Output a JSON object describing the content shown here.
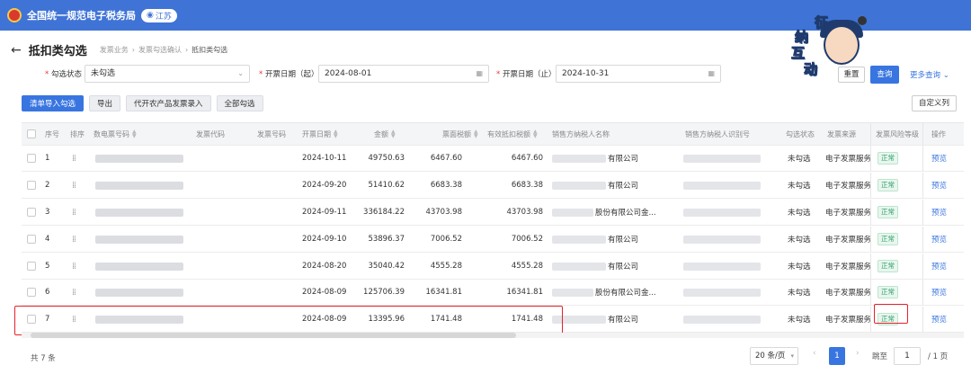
{
  "topbar": {
    "brand": "全国统一规范电子税务局",
    "region": "江苏",
    "region_icon": "location-icon"
  },
  "mascot": {
    "chars": [
      "征",
      "纳",
      "互",
      "动"
    ]
  },
  "header": {
    "back_icon": "←",
    "title": "抵扣类勾选",
    "breadcrumb": [
      "发票业务",
      "发票勾选确认",
      "抵扣类勾选"
    ]
  },
  "filters": {
    "status_label": "勾选状态",
    "status_value": "未勾选",
    "start_label": "开票日期（起）",
    "start_value": "2024-08-01",
    "end_label": "开票日期（止）",
    "end_value": "2024-10-31",
    "reset": "重置",
    "query": "查询",
    "more": "更多查询"
  },
  "actions": {
    "import": "清单导入勾选",
    "export": "导出",
    "agri": "代开农产品发票录入",
    "all": "全部勾选",
    "custom_cols": "自定义列"
  },
  "table": {
    "headers": {
      "index": "序号",
      "sort": "排序",
      "einv": "数电票号码",
      "code": "发票代码",
      "num": "发票号码",
      "date": "开票日期",
      "amount": "金额",
      "tax": "票面税额",
      "eff_tax": "有效抵扣税额",
      "seller": "销售方纳税人名称",
      "seller_id": "销售方纳税人识别号",
      "status": "勾选状态",
      "source": "发票来源",
      "risk": "发票风险等级",
      "op": "操作"
    },
    "rows": [
      {
        "index": "1",
        "date": "2024-10-11",
        "amount": "49750.63",
        "tax": "6467.60",
        "eff_tax": "6467.60",
        "seller": "有限公司",
        "status": "未勾选",
        "source": "电子发票服务",
        "risk": "正常",
        "op": "预览"
      },
      {
        "index": "2",
        "date": "2024-09-20",
        "amount": "51410.62",
        "tax": "6683.38",
        "eff_tax": "6683.38",
        "seller": "有限公司",
        "status": "未勾选",
        "source": "电子发票服务",
        "risk": "正常",
        "op": "预览"
      },
      {
        "index": "3",
        "date": "2024-09-11",
        "amount": "336184.22",
        "tax": "43703.98",
        "eff_tax": "43703.98",
        "seller": "股份有限公司金...",
        "status": "未勾选",
        "source": "电子发票服务",
        "risk": "正常",
        "op": "预览"
      },
      {
        "index": "4",
        "date": "2024-09-10",
        "amount": "53896.37",
        "tax": "7006.52",
        "eff_tax": "7006.52",
        "seller": "有限公司",
        "status": "未勾选",
        "source": "电子发票服务",
        "risk": "正常",
        "op": "预览"
      },
      {
        "index": "5",
        "date": "2024-08-20",
        "amount": "35040.42",
        "tax": "4555.28",
        "eff_tax": "4555.28",
        "seller": "有限公司",
        "status": "未勾选",
        "source": "电子发票服务",
        "risk": "正常",
        "op": "预览"
      },
      {
        "index": "6",
        "date": "2024-08-09",
        "amount": "125706.39",
        "tax": "16341.81",
        "eff_tax": "16341.81",
        "seller": "股份有限公司金...",
        "status": "未勾选",
        "source": "电子发票服务",
        "risk": "正常",
        "op": "预览"
      },
      {
        "index": "7",
        "date": "2024-08-09",
        "amount": "13395.96",
        "tax": "1741.48",
        "eff_tax": "1741.48",
        "seller": "有限公司",
        "status": "未勾选",
        "source": "电子发票服务",
        "risk": "正常",
        "op": "预览"
      }
    ]
  },
  "pager": {
    "total": "共 7 条",
    "size": "20 条/页",
    "page": "1",
    "jump": "跳至",
    "input": "1",
    "of": "/ 1 页"
  },
  "colors": {
    "topbar": "#3f74d6",
    "primary": "#3875e0",
    "highlight": "#e5222a",
    "ok": "#2ea06a"
  }
}
